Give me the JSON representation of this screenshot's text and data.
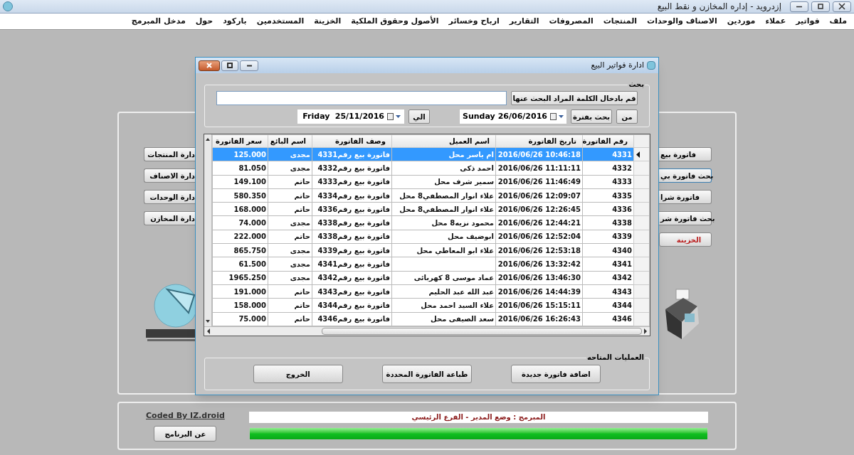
{
  "window": {
    "title": "إزدرويد  - إداره المخازن و نقط البيع"
  },
  "menu": [
    "ملف",
    "فواتير",
    "عملاء",
    "موردين",
    "الاصناف والوحدات",
    "المنتجات",
    "المصروفات",
    "التقارير",
    "ارباح وخسائر",
    "الأصول وحقوق الملكية",
    "الخزينة",
    "المستخدمين",
    "باركود",
    "حول",
    "مدخل المبرمج"
  ],
  "left_buttons": [
    "دارة المنتجات",
    "دارة الاصناف",
    "دارة الوحدات",
    "دارة المخازن"
  ],
  "right_buttons": [
    {
      "label": "فاتورة بيع",
      "focused": false
    },
    {
      "label": "بحث فاتورة بي",
      "focused": true
    },
    {
      "label": "فاتورة شرا",
      "focused": false
    },
    {
      "label": "بحث فاتورة شر",
      "focused": false
    },
    {
      "label": "الخزينة",
      "focused": false
    }
  ],
  "dialog": {
    "title": "ادارة فواتير البيع",
    "search": {
      "legend": "بحث",
      "hint_button": "قم بادخال الكلمة المراد البحث عنها",
      "from_label": "من",
      "period_button": "بحث بفترة",
      "from_date": {
        "day": "Sunday",
        "date": "26/06/2016"
      },
      "to_label": "الي",
      "to_date": {
        "day": "Friday",
        "date": "25/11/2016"
      }
    },
    "table": {
      "columns": [
        "رقم الفاتورة",
        "تاريخ الفاتورة",
        "اسم العميل",
        "وصف الفاتورة",
        "اسم البائع",
        "سعر الفاتورة"
      ],
      "rows": [
        {
          "selected": true,
          "cells": [
            "4331",
            "2016/06/26 10:46:18",
            "ام ياسر محل",
            "فاتورة بيع رقم4331",
            "مجدى",
            "125.000"
          ]
        },
        {
          "selected": false,
          "cells": [
            "4332",
            "2016/06/26 11:11:11",
            "احمد ذكى",
            "فاتورة بيع رقم4332",
            "مجدى",
            "81.050"
          ]
        },
        {
          "selected": false,
          "cells": [
            "4333",
            "2016/06/26 11:46:49",
            "سمير شرف محل",
            "فاتورة بيع رقم4333",
            "حاتم",
            "149.100"
          ]
        },
        {
          "selected": false,
          "cells": [
            "4335",
            "2016/06/26 12:09:07",
            "علاء انوار المصطفي8  محل",
            "فاتورة بيع رقم4334",
            "حاتم",
            "580.350"
          ]
        },
        {
          "selected": false,
          "cells": [
            "4336",
            "2016/06/26 12:26:45",
            "علاء انوار المصطفي8  محل",
            "فاتورة بيع رقم4336",
            "حاتم",
            "168.000"
          ]
        },
        {
          "selected": false,
          "cells": [
            "4338",
            "2016/06/26 12:44:21",
            "محمود نزيه8  محل",
            "فاتورة بيع رقم4338",
            "مجدى",
            "74.000"
          ]
        },
        {
          "selected": false,
          "cells": [
            "4339",
            "2016/06/26 12:52:04",
            "ابوضيف محل",
            "فاتورة بيع رقم4338",
            "حاتم",
            "222.000"
          ]
        },
        {
          "selected": false,
          "cells": [
            "4340",
            "2016/06/26 12:53:18",
            "علاء ابو المعاطي محل",
            "فاتورة بيع رقم4339",
            "مجدى",
            "865.750"
          ]
        },
        {
          "selected": false,
          "cells": [
            "4341",
            "2016/06/26 13:32:42",
            "",
            "فاتورة بيع رقم4341",
            "مجدى",
            "61.500"
          ]
        },
        {
          "selected": false,
          "cells": [
            "4342",
            "2016/06/26 13:46:30",
            "عماد موسى 8 كهربائى",
            "فاتورة بيع رقم4342",
            "مجدى",
            "1965.250"
          ]
        },
        {
          "selected": false,
          "cells": [
            "4343",
            "2016/06/26 14:44:39",
            "عبد الله عبد الحليم",
            "فاتورة بيع رقم4343",
            "حاتم",
            "191.000"
          ]
        },
        {
          "selected": false,
          "cells": [
            "4344",
            "2016/06/26 15:15:11",
            "علاء السيد احمد محل",
            "فاتورة بيع رقم4344",
            "حاتم",
            "158.000"
          ]
        },
        {
          "selected": false,
          "cells": [
            "4346",
            "2016/06/26 16:26:43",
            "سعد الصيفى محل",
            "فاتورة بيع رقم4346",
            "حاتم",
            "75.000"
          ]
        }
      ]
    },
    "operations": {
      "legend": "العمليات المتاحه",
      "buttons": [
        "اضافة فاتورة جديدة",
        "طباعة الفاتورة المحددة",
        "الخروج"
      ]
    }
  },
  "footer": {
    "credit": "Coded By IZ.droid",
    "about_button": "عن البرنامج",
    "status": "المبرمج : وضع المدير - الفرع الرئيسي",
    "progress": {
      "level": 1.0
    }
  }
}
